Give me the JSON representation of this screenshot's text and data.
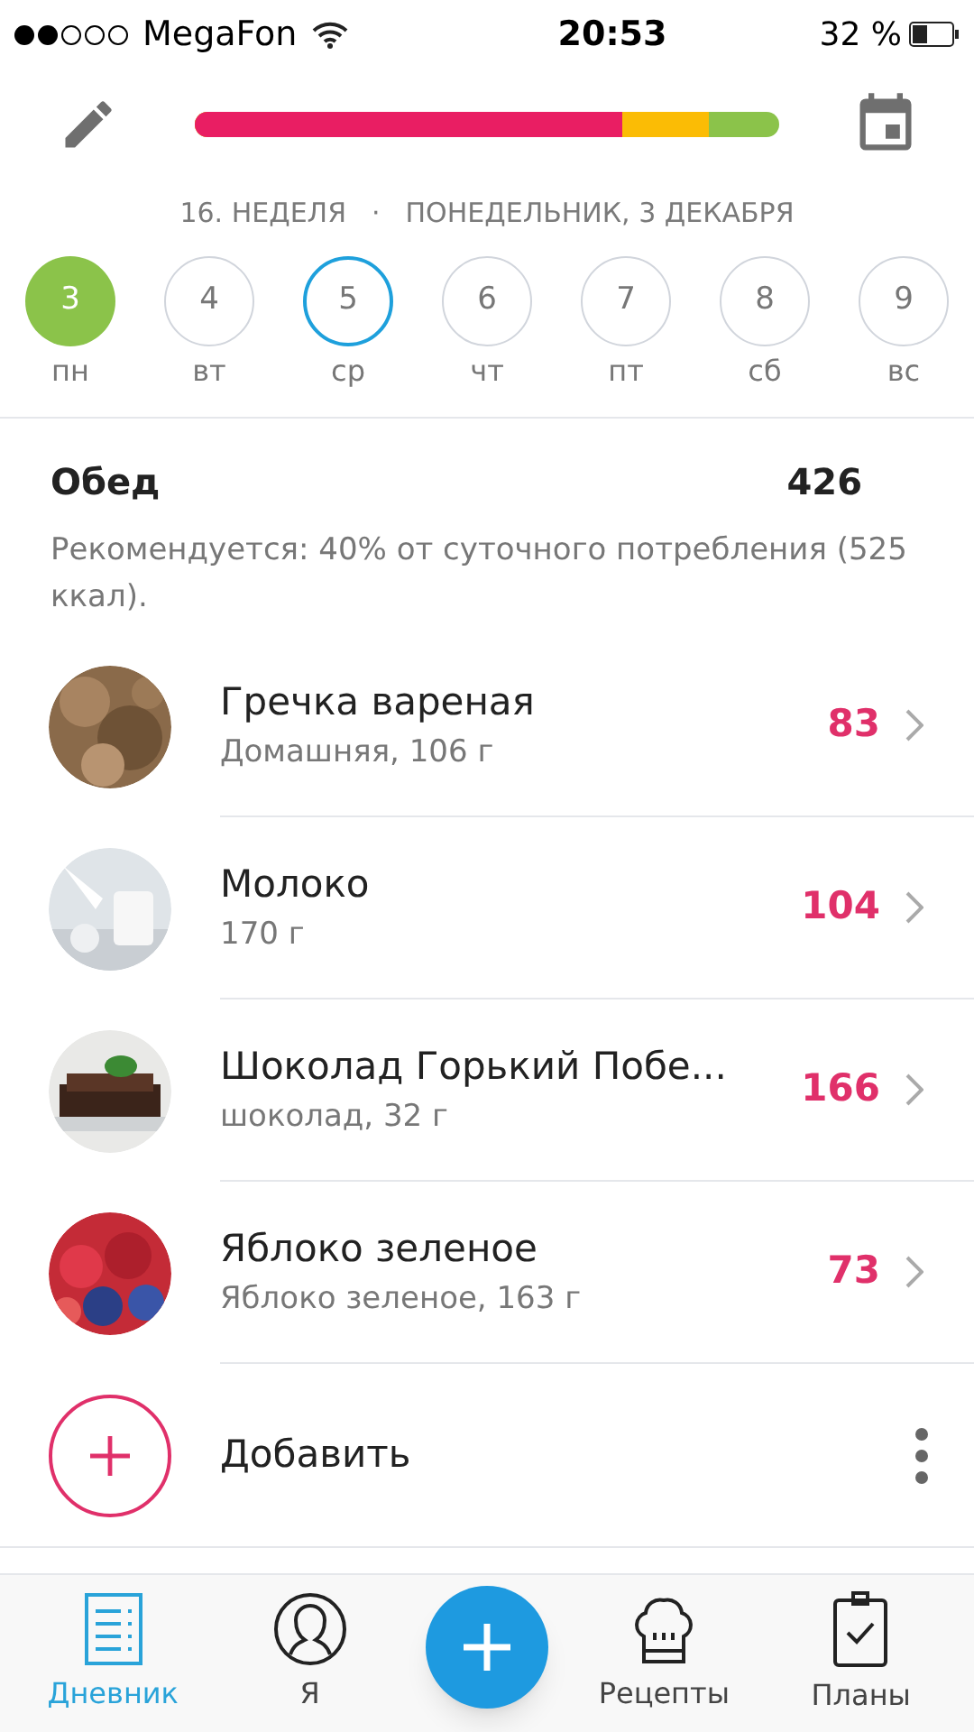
{
  "status_bar": {
    "carrier": "MegaFon",
    "time": "20:53",
    "battery": "32 %"
  },
  "header": {
    "progress": {
      "color": "#8bc34a",
      "segments": [
        {
          "level": 0.73,
          "color": "#e91e63"
        },
        {
          "level": 0.88,
          "color": "#fbbc05"
        }
      ]
    }
  },
  "week": {
    "week_label": "16. НЕДЕЛЯ",
    "separator": "·",
    "date": "ПОНЕДЕЛЬНИК, 3 ДЕКАБРЯ"
  },
  "days": [
    {
      "number": "3",
      "weekday": "пн",
      "selected": true,
      "today": false
    },
    {
      "number": "4",
      "weekday": "вт",
      "selected": false,
      "today": false
    },
    {
      "number": "5",
      "weekday": "ср",
      "selected": false,
      "today": true
    },
    {
      "number": "6",
      "weekday": "чт",
      "selected": false,
      "today": false
    },
    {
      "number": "7",
      "weekday": "пт",
      "selected": false,
      "today": false
    },
    {
      "number": "8",
      "weekday": "сб",
      "selected": false,
      "today": false
    },
    {
      "number": "9",
      "weekday": "вс",
      "selected": false,
      "today": false
    }
  ],
  "meal": {
    "title": "Обед",
    "calories": "426",
    "recommendation": "Рекомендуется: 40% от суточного потребления (525 ккал)."
  },
  "foods": [
    {
      "name": "Гречка вареная",
      "detail": "Домашняя, 106 г",
      "calories": "83"
    },
    {
      "name": "Молоко",
      "detail": "170 г",
      "calories": "104"
    },
    {
      "name": "Шоколад Горький Побе...",
      "detail": "шоколад, 32 г",
      "calories": "166"
    },
    {
      "name": "Яблоко зеленое",
      "detail": "Яблоко зеленое, 163 г",
      "calories": "73"
    }
  ],
  "add_label": "Добавить",
  "tab_bar": [
    {
      "label": "Дневник",
      "kind": "diary",
      "selected": true
    },
    {
      "label": "Я",
      "kind": "profile",
      "selected": false
    },
    {
      "kind": "add"
    },
    {
      "label": "Рецепты",
      "kind": "recipes",
      "selected": false
    },
    {
      "label": "Планы",
      "kind": "plans",
      "selected": false
    }
  ]
}
